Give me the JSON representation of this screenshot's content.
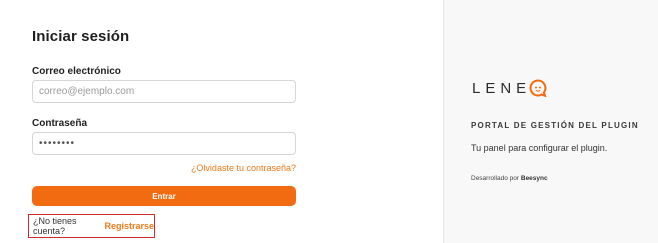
{
  "login": {
    "title": "Iniciar sesión",
    "email_label": "Correo electrónico",
    "email_placeholder": "correo@ejemplo.com",
    "password_label": "Contraseña",
    "password_value": "••••••••",
    "forgot_link": "¿Olvidaste tu contraseña?",
    "submit_label": "Entrar",
    "signup_prompt": "¿No tienes cuenta?",
    "signup_link": "Registrarse"
  },
  "brand": {
    "logo_text": "LENE",
    "logo_icon": "chat-bubble-icon",
    "portal_title": "PORTAL DE GESTIÓN DEL PLUGIN",
    "tagline": "Tu panel para configurar el plugin.",
    "developed_by_label": "Desarrollado por",
    "developer": "Beesync"
  },
  "colors": {
    "accent": "#f26b10",
    "link": "#f07a1a",
    "highlight_border": "#cf2b2b",
    "panel_bg": "#f8f8f8"
  }
}
